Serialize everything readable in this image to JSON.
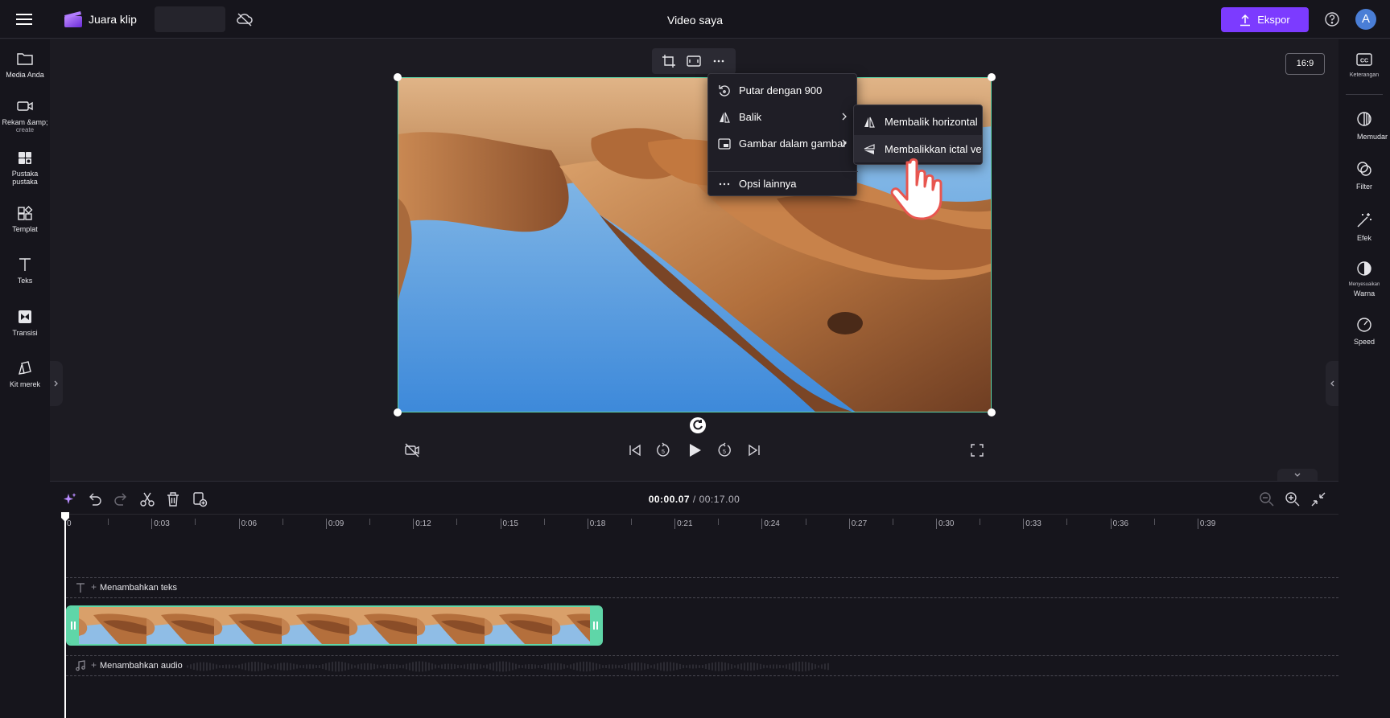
{
  "header": {
    "app_name": "Juara klip",
    "video_title": "Video saya",
    "export_label": "Ekspor",
    "avatar_initial": "A"
  },
  "left_sidebar": {
    "items": [
      {
        "label": "Media Anda",
        "icon": "folder-icon"
      },
      {
        "label": "Rekam &amp;",
        "sublabel": "create",
        "icon": "camera-icon"
      },
      {
        "label": "Pustaka pustaka",
        "icon": "content-library-icon"
      },
      {
        "label": "Templat",
        "icon": "templates-icon"
      },
      {
        "label": "Teks",
        "icon": "text-icon"
      },
      {
        "label": "Transisi",
        "icon": "transitions-icon"
      },
      {
        "label": "Kit merek",
        "icon": "brand-kit-icon"
      }
    ]
  },
  "right_sidebar": {
    "items": [
      {
        "label": "Keterangan",
        "icon": "captions-icon"
      },
      {
        "label": "Memudar",
        "icon": "fade-icon"
      },
      {
        "label": "Filter",
        "icon": "filters-icon"
      },
      {
        "label": "Efek",
        "icon": "effects-icon"
      },
      {
        "label": "Menyesuaikan",
        "label2": "Warna",
        "icon": "adjust-colors-icon"
      },
      {
        "label": "Speed",
        "icon": "speed-icon"
      }
    ]
  },
  "stage": {
    "aspect_ratio": "16:9"
  },
  "context_menu": {
    "items": [
      {
        "label": "Putar dengan 900",
        "icon": "rotate-icon"
      },
      {
        "label": "Balik",
        "icon": "flip-icon",
        "has_submenu": true
      },
      {
        "label": "Gambar dalam gambar",
        "icon": "picture-in-picture-icon",
        "has_submenu": true
      },
      {
        "label": "Opsi lainnya",
        "icon": "more-icon"
      }
    ],
    "submenu": [
      {
        "label": "Membalik horizontal",
        "icon": "flip-horizontal-icon"
      },
      {
        "label": "Membalikkan ictal vet",
        "icon": "flip-vertical-icon",
        "hovered": true
      }
    ]
  },
  "timeline": {
    "current_time": "00:00.07",
    "separator": " / ",
    "total_time": "00:17.00",
    "ruler_labels": [
      "0",
      "0:03",
      "0:06",
      "0:09",
      "0:12",
      "0:15",
      "0:18",
      "0:21",
      "0:24",
      "0:27",
      "0:30",
      "0:33",
      "0:36",
      "0:39"
    ],
    "text_track_label": "Menambahkan teks",
    "audio_track_label": "Menambahkan audio"
  },
  "colors": {
    "accent": "#7c3bff",
    "selection": "#5fd6a8",
    "background": "#1c1b22",
    "panel": "#16151c"
  }
}
